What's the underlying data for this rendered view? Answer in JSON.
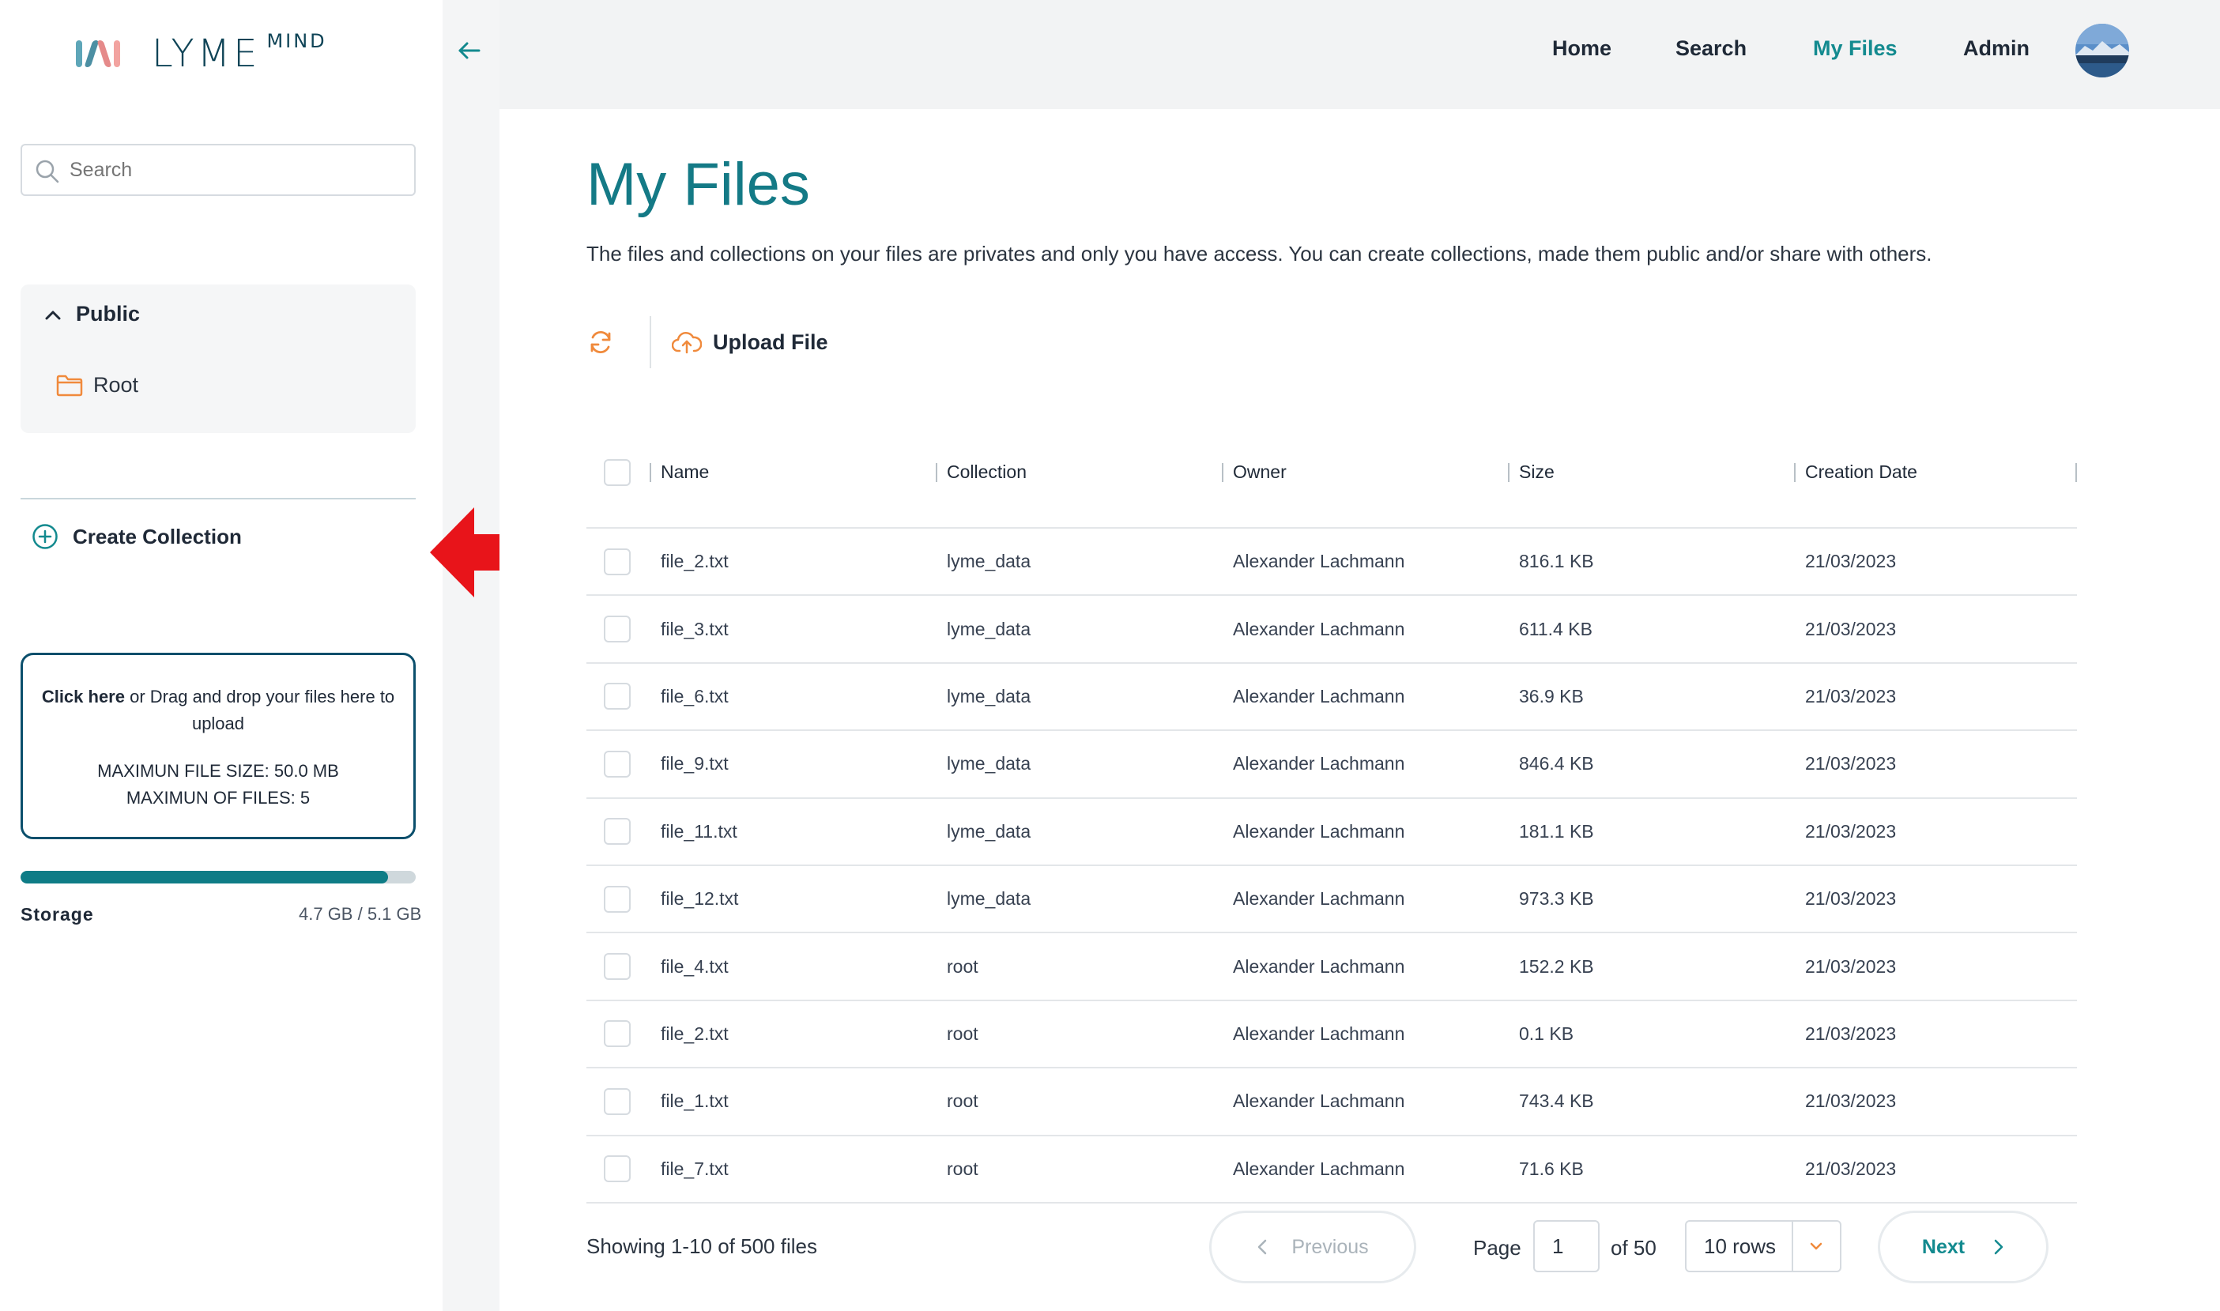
{
  "brand": {
    "name": "LYME",
    "superscript": "MIND",
    "mark_colors": [
      "#5ea6b8",
      "#4c8fa3",
      "#e58a8a",
      "#f2a3a0"
    ]
  },
  "sidebar": {
    "search_placeholder": "Search",
    "public_section": {
      "title": "Public",
      "items": [
        {
          "label": "Root"
        }
      ]
    },
    "create_collection_label": "Create Collection",
    "dropzone": {
      "click_here": "Click here",
      "instruction_rest": " or Drag and drop your files here to upload",
      "max_size": "MAXIMUN FILE SIZE: 50.0 MB",
      "max_files": "MAXIMUN OF FILES: 5"
    },
    "storage": {
      "label": "Storage",
      "value": "4.7 GB / 5.1 GB",
      "used_fraction": 0.93
    }
  },
  "nav": {
    "items": [
      {
        "label": "Home",
        "active": false
      },
      {
        "label": "Search",
        "active": false
      },
      {
        "label": "My Files",
        "active": true
      },
      {
        "label": "Admin",
        "active": false
      }
    ]
  },
  "main": {
    "title": "My Files",
    "description": "The files and collections on your files are privates and only you have access. You can create collections, made them public and/or share with others.",
    "upload_label": "Upload File",
    "table": {
      "columns": [
        "Name",
        "Collection",
        "Owner",
        "Size",
        "Creation Date"
      ],
      "rows": [
        [
          "file_2.txt",
          "lyme_data",
          "Alexander Lachmann",
          "816.1 KB",
          "21/03/2023"
        ],
        [
          "file_3.txt",
          "lyme_data",
          "Alexander Lachmann",
          "611.4 KB",
          "21/03/2023"
        ],
        [
          "file_6.txt",
          "lyme_data",
          "Alexander Lachmann",
          "36.9 KB",
          "21/03/2023"
        ],
        [
          "file_9.txt",
          "lyme_data",
          "Alexander Lachmann",
          "846.4 KB",
          "21/03/2023"
        ],
        [
          "file_11.txt",
          "lyme_data",
          "Alexander Lachmann",
          "181.1 KB",
          "21/03/2023"
        ],
        [
          "file_12.txt",
          "lyme_data",
          "Alexander Lachmann",
          "973.3 KB",
          "21/03/2023"
        ],
        [
          "file_4.txt",
          "root",
          "Alexander Lachmann",
          "152.2 KB",
          "21/03/2023"
        ],
        [
          "file_2.txt",
          "root",
          "Alexander Lachmann",
          "0.1 KB",
          "21/03/2023"
        ],
        [
          "file_1.txt",
          "root",
          "Alexander Lachmann",
          "743.4 KB",
          "21/03/2023"
        ],
        [
          "file_7.txt",
          "root",
          "Alexander Lachmann",
          "71.6 KB",
          "21/03/2023"
        ]
      ]
    },
    "pagination": {
      "showing": "Showing 1-10 of 500 files",
      "previous_label": "Previous",
      "page_label": "Page",
      "current_page": "1",
      "of_label": "of 50",
      "rows_label": "10 rows",
      "next_label": "Next"
    }
  },
  "colors": {
    "accent": "#138a8f",
    "title": "#147a86",
    "icon_orange": "#f08a3c",
    "arrow_red": "#e8141a",
    "dropzone_border": "#0b4f6c"
  }
}
